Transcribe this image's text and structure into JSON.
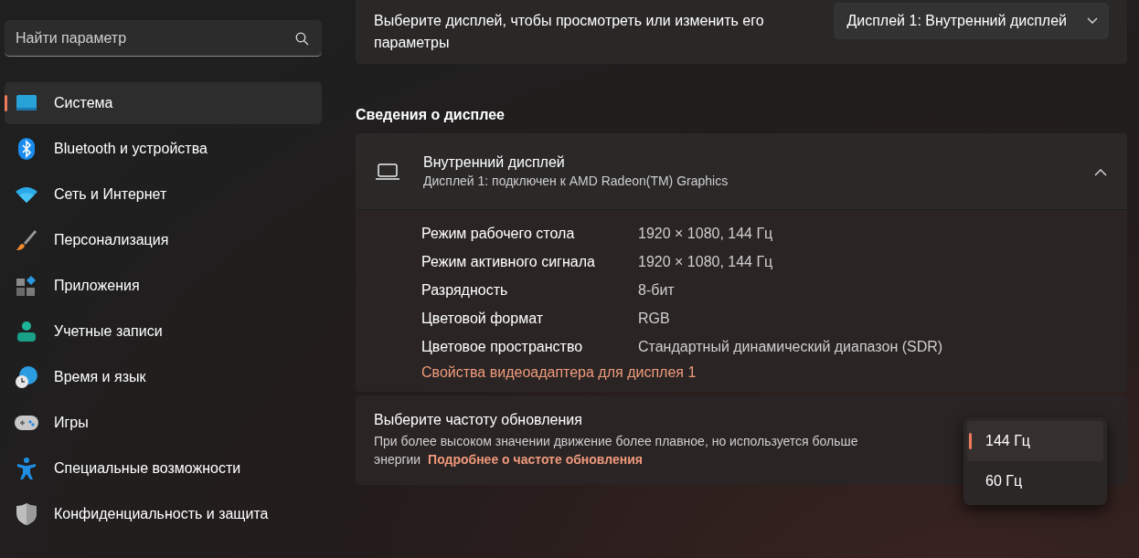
{
  "search": {
    "placeholder": "Найти параметр"
  },
  "sidebar": {
    "items": [
      {
        "label": "Система",
        "selected": true
      },
      {
        "label": "Bluetooth и устройства",
        "selected": false
      },
      {
        "label": "Сеть и Интернет",
        "selected": false
      },
      {
        "label": "Персонализация",
        "selected": false
      },
      {
        "label": "Приложения",
        "selected": false
      },
      {
        "label": "Учетные записи",
        "selected": false
      },
      {
        "label": "Время и язык",
        "selected": false
      },
      {
        "label": "Игры",
        "selected": false
      },
      {
        "label": "Специальные возможности",
        "selected": false
      },
      {
        "label": "Конфиденциальность и защита",
        "selected": false
      }
    ]
  },
  "display_select": {
    "label": "Выберите дисплей, чтобы просмотреть или изменить его параметры",
    "value": "Дисплей 1: Внутренний дисплей"
  },
  "section_title": "Сведения о дисплее",
  "display_info": {
    "title": "Внутренний дисплей",
    "subtitle": "Дисплей 1: подключен к AMD Radeon(TM) Graphics",
    "expanded": true,
    "rows": [
      {
        "label": "Режим рабочего стола",
        "value": "1920 × 1080, 144 Гц"
      },
      {
        "label": "Режим активного сигнала",
        "value": "1920 × 1080, 144 Гц"
      },
      {
        "label": "Разрядность",
        "value": "8-бит"
      },
      {
        "label": "Цветовой формат",
        "value": "RGB"
      },
      {
        "label": "Цветовое пространство",
        "value": "Стандартный динамический диапазон (SDR)"
      }
    ],
    "link": "Свойства видеоадаптера для дисплея 1"
  },
  "refresh_rate": {
    "title": "Выберите частоту обновления",
    "description": "При более высоком значении движение более плавное, но используется больше энергии",
    "link": "Подробнее о частоте обновления",
    "options": [
      {
        "label": "144 Гц",
        "selected": true
      },
      {
        "label": "60 Гц",
        "selected": false
      }
    ]
  }
}
